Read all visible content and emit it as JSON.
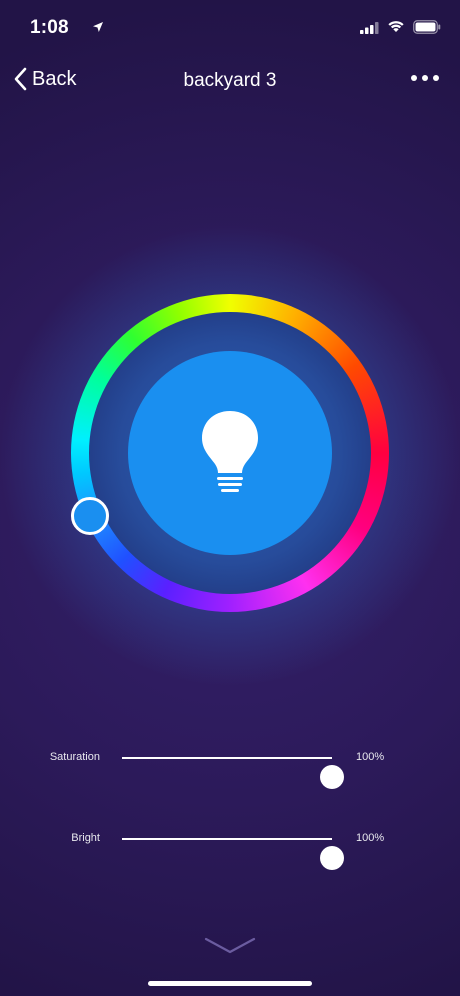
{
  "status_bar": {
    "time": "1:08",
    "icons": [
      "location-arrow-icon",
      "cellular-signal-icon",
      "wifi-icon",
      "battery-icon"
    ]
  },
  "nav": {
    "back_label": "Back",
    "title": "backyard 3",
    "back_icon": "chevron-left-icon",
    "more_icon": "more-horizontal-icon"
  },
  "color_wheel": {
    "selected_color": "#1a8ff0",
    "center_icon": "lightbulb-icon"
  },
  "sliders": [
    {
      "label": "Saturation",
      "value": "100%",
      "level": 1.0
    },
    {
      "label": "Bright",
      "value": "100%",
      "level": 1.0
    }
  ],
  "footer": {
    "collapse_icon": "chevron-down-icon"
  },
  "colors": {
    "background": "#2a1a4f",
    "accent": "#1a8ff0",
    "text": "#ffffff"
  }
}
